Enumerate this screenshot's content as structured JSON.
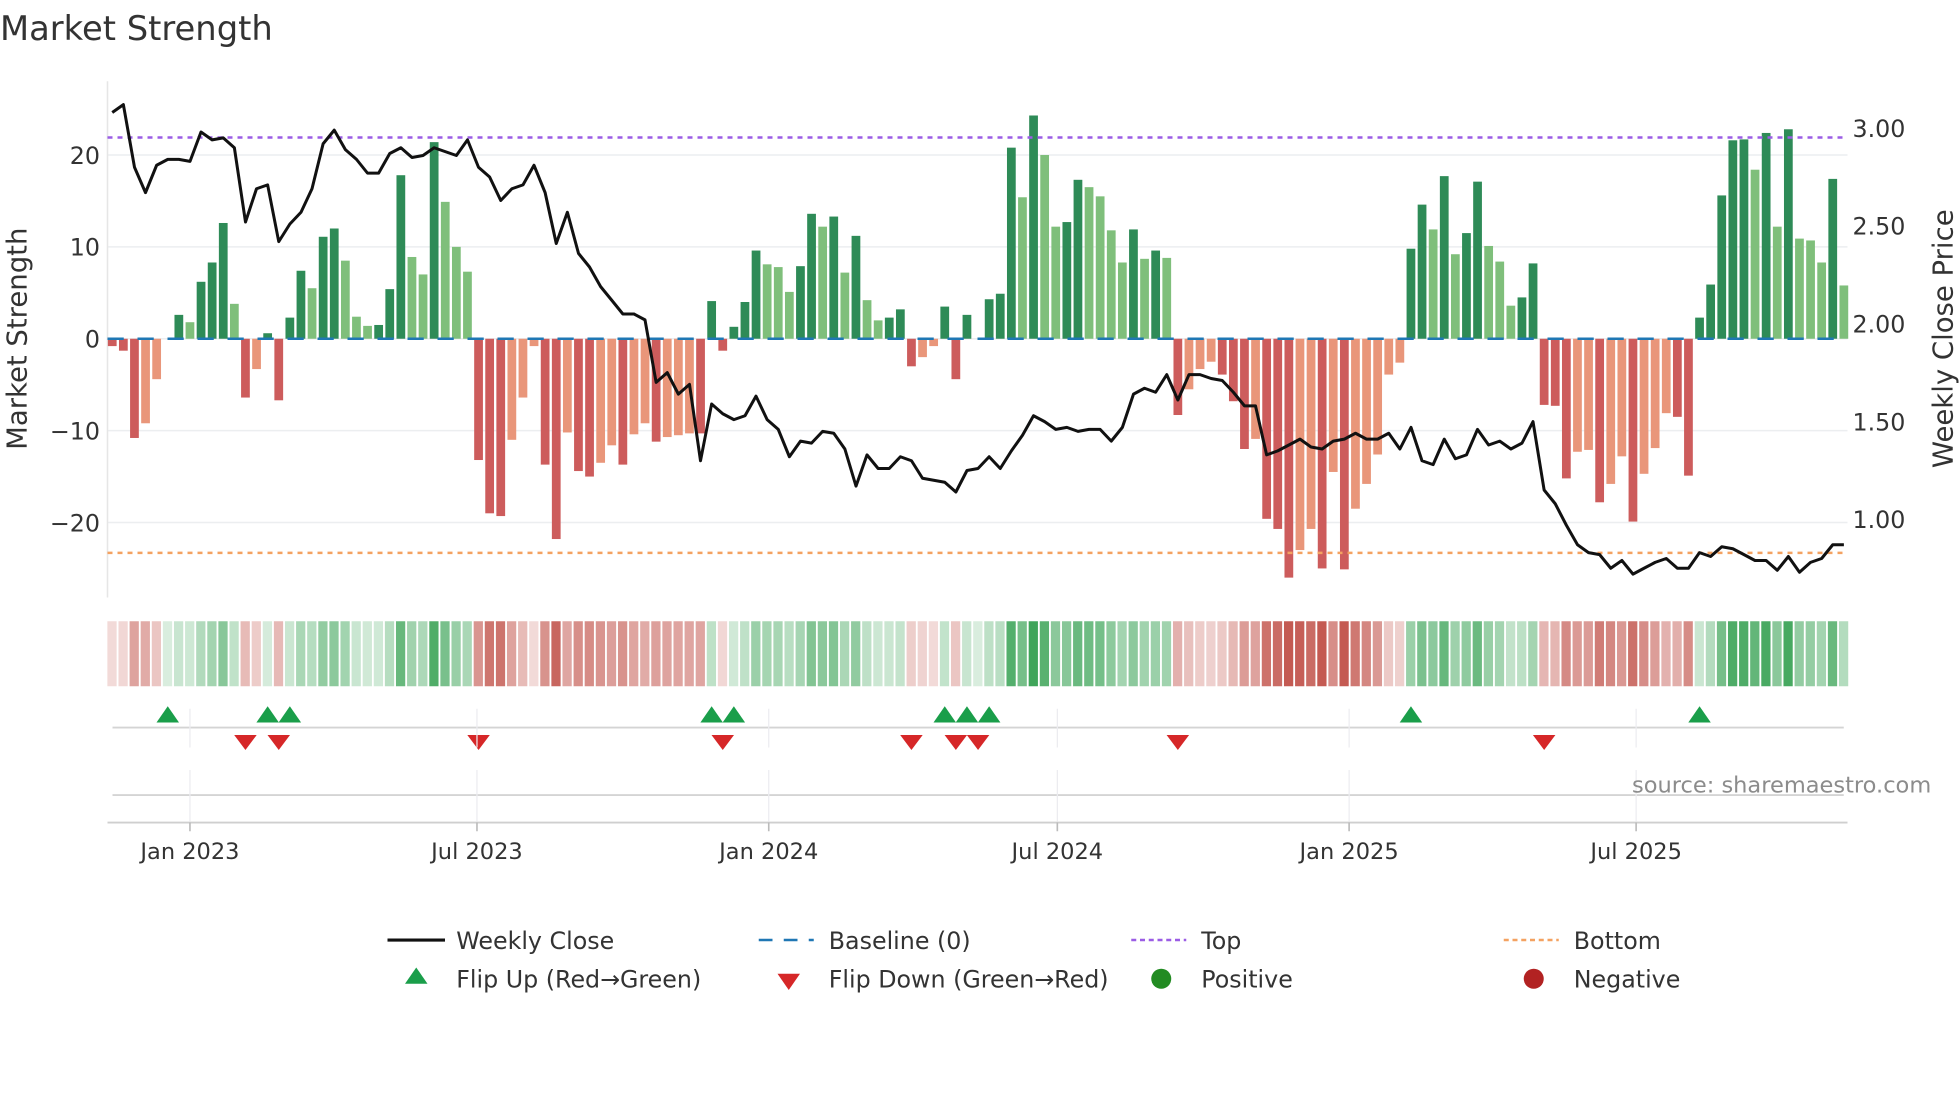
{
  "chart_data": {
    "type": "bar",
    "title": "Market Strength",
    "ylabel": "Market Strength",
    "y2label": "Weekly Close Price",
    "x_start": "2022-11-13",
    "x_interval": "weekly",
    "ylim": [
      -27,
      27
    ],
    "y2lim": [
      0.65,
      3.2
    ],
    "yticks": [
      20,
      10,
      0,
      -10,
      -20
    ],
    "ytick_labels": [
      "20",
      "10",
      "0",
      "−10",
      "−20"
    ],
    "y2ticks": [
      3.0,
      2.5,
      2.0,
      1.5,
      1.0
    ],
    "y2tick_labels": [
      "3.00",
      "2.50",
      "2.00",
      "1.50",
      "1.00"
    ],
    "xticks": [
      "2023-01-01",
      "2023-07-01",
      "2024-01-01",
      "2024-07-01",
      "2025-01-01",
      "2025-07-01"
    ],
    "xtick_labels": [
      "Jan 2023",
      "Jul 2023",
      "Jan 2024",
      "Jul 2024",
      "Jan 2025",
      "Jul 2025"
    ],
    "grid": true,
    "top_level": 21.9,
    "bottom_level": -23.3,
    "baseline": 0,
    "strength": [
      -0.8,
      -1.3,
      -10.8,
      -9.2,
      -4.4,
      0,
      2.6,
      1.8,
      6.2,
      8.3,
      12.6,
      3.8,
      -6.4,
      -3.3,
      0.6,
      -6.7,
      2.3,
      7.4,
      5.5,
      11.1,
      12,
      8.5,
      2.4,
      1.4,
      1.5,
      5.4,
      17.8,
      8.9,
      7.0,
      21.4,
      14.9,
      10,
      7.3,
      -13.2,
      -19,
      -19.3,
      -11,
      -6.4,
      -0.8,
      -13.7,
      -21.8,
      -10.2,
      -14.4,
      -15,
      -13.5,
      -11.6,
      -13.7,
      -10.4,
      -9.2,
      -11.2,
      -10.7,
      -10.5,
      -10.3,
      -10.3,
      4.1,
      -1.3,
      1.3,
      4,
      9.6,
      8.1,
      7.8,
      5.1,
      7.9,
      13.6,
      12.2,
      13.3,
      7.2,
      11.2,
      4.2,
      2,
      2.3,
      3.2,
      -3,
      -2,
      -0.8,
      3.5,
      -4.4,
      2.6,
      0,
      4.3,
      4.9,
      20.8,
      15.4,
      24.3,
      20,
      12.2,
      12.7,
      17.3,
      16.5,
      15.5,
      11.8,
      8.3,
      11.9,
      8.7,
      9.6,
      8.8,
      -8.3,
      -5.5,
      -3.3,
      -2.5,
      -3.9,
      -6.8,
      -12,
      -10.9,
      -19.6,
      -20.7,
      -26,
      -23,
      -20.7,
      -25,
      -14.5,
      -25.1,
      -18.5,
      -15.8,
      -12.6,
      -3.9,
      -2.6,
      9.8,
      14.6,
      11.9,
      17.7,
      9.2,
      11.5,
      17.1,
      10.1,
      8.4,
      3.6,
      4.5,
      8.2,
      -7.2,
      -7.3,
      -15.2,
      -12.3,
      -12.1,
      -17.8,
      -15.8,
      -12.8,
      -19.9,
      -14.7,
      -11.9,
      -8.1,
      -8.5,
      -14.9,
      2.3,
      5.9,
      15.6,
      21.6,
      21.7,
      18.4,
      22.4,
      12.2,
      22.8,
      10.9,
      10.7,
      8.3,
      17.4,
      5.8
    ],
    "weekly_close": [
      3.08,
      3.12,
      2.8,
      2.67,
      2.81,
      2.84,
      2.84,
      2.83,
      2.98,
      2.94,
      2.95,
      2.9,
      2.52,
      2.69,
      2.71,
      2.42,
      2.51,
      2.57,
      2.69,
      2.92,
      2.99,
      2.89,
      2.84,
      2.77,
      2.77,
      2.87,
      2.9,
      2.85,
      2.86,
      2.9,
      2.88,
      2.86,
      2.94,
      2.8,
      2.75,
      2.63,
      2.69,
      2.71,
      2.81,
      2.67,
      2.41,
      2.57,
      2.36,
      2.29,
      2.19,
      2.12,
      2.05,
      2.05,
      2.02,
      1.7,
      1.75,
      1.64,
      1.69,
      1.3,
      1.59,
      1.54,
      1.51,
      1.53,
      1.63,
      1.51,
      1.46,
      1.32,
      1.4,
      1.39,
      1.45,
      1.44,
      1.36,
      1.17,
      1.33,
      1.26,
      1.26,
      1.32,
      1.3,
      1.21,
      1.2,
      1.19,
      1.14,
      1.25,
      1.26,
      1.32,
      1.26,
      1.35,
      1.43,
      1.53,
      1.5,
      1.46,
      1.47,
      1.45,
      1.46,
      1.46,
      1.4,
      1.47,
      1.64,
      1.67,
      1.65,
      1.74,
      1.61,
      1.74,
      1.74,
      1.72,
      1.71,
      1.65,
      1.58,
      1.58,
      1.33,
      1.35,
      1.38,
      1.41,
      1.37,
      1.36,
      1.4,
      1.41,
      1.44,
      1.41,
      1.41,
      1.44,
      1.36,
      1.47,
      1.3,
      1.28,
      1.41,
      1.31,
      1.33,
      1.46,
      1.38,
      1.4,
      1.36,
      1.39,
      1.5,
      1.15,
      1.08,
      0.97,
      0.87,
      0.83,
      0.82,
      0.75,
      0.79,
      0.72,
      0.75,
      0.78,
      0.8,
      0.75,
      0.75,
      0.83,
      0.81,
      0.86,
      0.85,
      0.82,
      0.79,
      0.79,
      0.74,
      0.81,
      0.73,
      0.78,
      0.8,
      0.87,
      0.87
    ],
    "flip_up_weeks": [
      5,
      14,
      16,
      54,
      56,
      75,
      77,
      79,
      117,
      143
    ],
    "flip_down_weeks": [
      12,
      15,
      33,
      55,
      72,
      76,
      78,
      96,
      129
    ],
    "legend": {
      "placement": "bottom",
      "entries": [
        "Weekly Close",
        "Baseline (0)",
        "Top",
        "Bottom",
        "Flip Up (Red→Green)",
        "Flip Down (Green→Red)",
        "Positive",
        "Negative"
      ]
    },
    "annotation": "source: sharemaestro.com"
  },
  "colors": {
    "rising_positive": "#2e8b57",
    "falling_positive": "#7fbf7b",
    "falling_negative": "#cd5c5c",
    "rising_negative": "#e9967a",
    "weekly_close": "#111111",
    "baseline": "#1f77b4",
    "top": "#9b5de5",
    "bottom": "#f4a261",
    "flip_up": "#1a9e4a",
    "flip_down": "#d62728",
    "positive": "#228b22",
    "negative": "#b22222"
  }
}
